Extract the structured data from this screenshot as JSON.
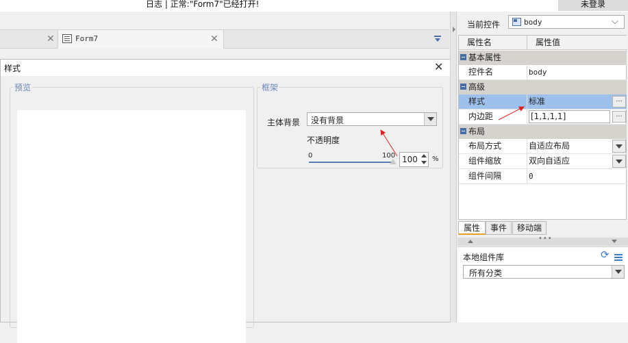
{
  "status_bar": {
    "log_text": "日志 | 正常:\"Form7\"已经打开!",
    "login_label": "未登录"
  },
  "editor_tabs": {
    "active_tab": "Form7"
  },
  "style_dialog": {
    "title": "样式",
    "preview_group": "预览",
    "frame_group": "框架",
    "background_label": "主体背景",
    "background_value": "没有背景",
    "opacity_label": "不透明度",
    "slider_min": "0",
    "slider_max": "100",
    "opacity_value": "100",
    "opacity_fraction": 1.0,
    "percent_sign": "%"
  },
  "properties": {
    "current_control_label": "当前控件",
    "current_control_value": "body",
    "col_name": "属性名",
    "col_value": "属性值",
    "categories": {
      "basic": "基本属性",
      "advanced": "高级",
      "layout": "布局"
    },
    "rows": {
      "control_name": {
        "name": "控件名",
        "value": "body"
      },
      "style": {
        "name": "样式",
        "value": "标准"
      },
      "padding": {
        "name": "内边距",
        "value": "[1,1,1,1]"
      },
      "layout_mode": {
        "name": "布局方式",
        "value": "自适应布局"
      },
      "component_scale": {
        "name": "组件缩放",
        "value": "双向自适应"
      },
      "component_spacing": {
        "name": "组件间隔",
        "value": "0"
      }
    },
    "ellipsis": "...",
    "tabs": {
      "properties": "属性",
      "events": "事件",
      "mobile": "移动端"
    }
  },
  "library": {
    "title": "本地组件库",
    "category_value": "所有分类"
  },
  "colors": {
    "selected_row": "#9ec1ec",
    "accent_blue": "#4a6fa8",
    "annotation_red": "#e02020",
    "active_tab_underline": "#e5a02b"
  }
}
